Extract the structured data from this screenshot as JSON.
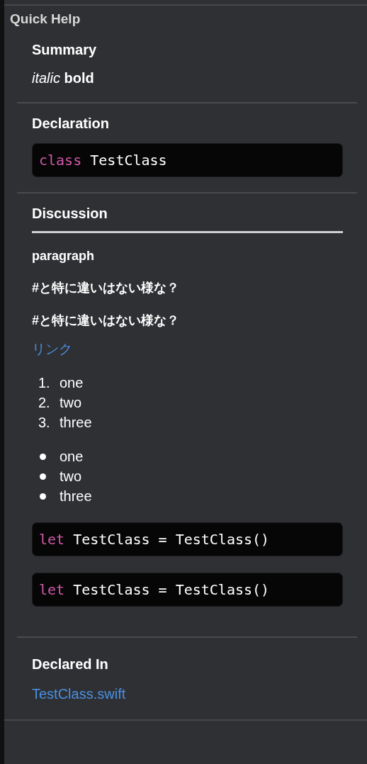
{
  "panel": {
    "title": "Quick Help"
  },
  "summary": {
    "heading": "Summary",
    "text": "*italic* **bold**"
  },
  "declaration": {
    "heading": "Declaration",
    "code": {
      "keyword": "class",
      "rest": " TestClass"
    }
  },
  "discussion": {
    "heading": "Discussion",
    "blocks": [
      {
        "kind": "heading",
        "text": "paragraph"
      },
      {
        "kind": "heading",
        "text": "#と特に違いはない様な？"
      },
      {
        "kind": "heading",
        "text": "#と特に違いはない様な？"
      },
      {
        "kind": "link",
        "text": "リンク"
      },
      {
        "kind": "ordered",
        "items": [
          {
            "number": "1.",
            "text": "one"
          },
          {
            "number": "2.",
            "text": "two"
          },
          {
            "number": "3.",
            "text": "three"
          }
        ]
      },
      {
        "kind": "bullets",
        "items": [
          {
            "text": "one"
          },
          {
            "text": "two"
          },
          {
            "text": "three"
          }
        ]
      },
      {
        "kind": "code",
        "keyword": "let",
        "rest": " TestClass = TestClass()"
      },
      {
        "kind": "code",
        "keyword": "let",
        "rest": " TestClass = TestClass()"
      }
    ]
  },
  "declared_in": {
    "heading": "Declared In",
    "link": "TestClass.swift"
  }
}
